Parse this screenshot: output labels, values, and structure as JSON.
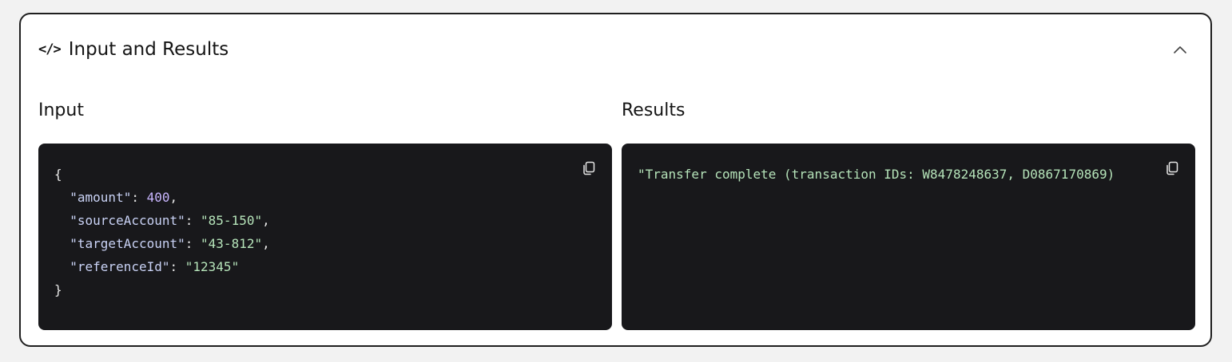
{
  "card": {
    "title": "Input and Results",
    "code_icon": "</>",
    "collapse_icon": "chevron-up-icon"
  },
  "input": {
    "label": "Input",
    "open_brace": "{",
    "close_brace": "}",
    "fields": [
      {
        "key": "\"amount\"",
        "sep": ": ",
        "value": "400",
        "type": "number",
        "trail": ","
      },
      {
        "key": "\"sourceAccount\"",
        "sep": ": ",
        "value": "\"85-150\"",
        "type": "string",
        "trail": ","
      },
      {
        "key": "\"targetAccount\"",
        "sep": ": ",
        "value": "\"43-812\"",
        "type": "string",
        "trail": ","
      },
      {
        "key": "\"referenceId\"",
        "sep": ": ",
        "value": "\"12345\"",
        "type": "string",
        "trail": ""
      }
    ],
    "copy_icon": "copy-icon"
  },
  "results": {
    "label": "Results",
    "text": "\"Transfer complete (transaction IDs: W8478248637, D0867170869)",
    "copy_icon": "copy-icon"
  },
  "colors": {
    "panel_bg": "#18181b",
    "key": "#c9d2f5",
    "number": "#c9b6ff",
    "string": "#b5e3b9"
  }
}
